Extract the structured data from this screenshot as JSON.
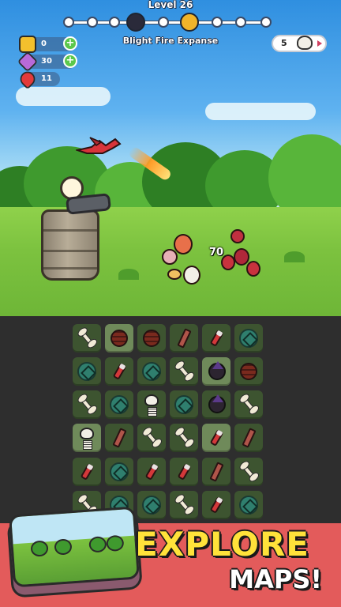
{
  "hud": {
    "level_label": "Level 26",
    "zone_name": "Blight Fire Expanse",
    "progress": {
      "nodes_total": 8,
      "current_index": 4,
      "cleared": 2
    },
    "resources": [
      {
        "name": "gold",
        "icon": "gold-coin-icon",
        "value": "0",
        "color": "#f3c02d"
      },
      {
        "name": "gems",
        "icon": "purple-gem-icon",
        "value": "30",
        "color": "#b86ad9"
      },
      {
        "name": "lives",
        "icon": "heart-icon",
        "value": "11",
        "color": "#e23a3a"
      }
    ],
    "kill_count": "5"
  },
  "battle": {
    "damage_number": "70"
  },
  "board": {
    "rows": [
      [
        "bone",
        "barrel",
        "barrel",
        "plank",
        "tube",
        "coin"
      ],
      [
        "coin",
        "tube",
        "coin",
        "bone",
        "witch",
        "barrel"
      ],
      [
        "bone",
        "coin",
        "skeleton",
        "coin",
        "witch",
        "bone"
      ],
      [
        "skeleton",
        "plank",
        "bone",
        "bone",
        "tube",
        "plank"
      ],
      [
        "tube",
        "coin",
        "tube",
        "tube",
        "plank",
        "bone"
      ],
      [
        "bone",
        "coin",
        "coin",
        "bone",
        "tube",
        "coin"
      ]
    ],
    "highlighted": [
      [
        0,
        1
      ],
      [
        1,
        4
      ],
      [
        3,
        0
      ],
      [
        3,
        4
      ]
    ]
  },
  "promo": {
    "line1": "EXPLORE",
    "line2": "MAPS!"
  }
}
